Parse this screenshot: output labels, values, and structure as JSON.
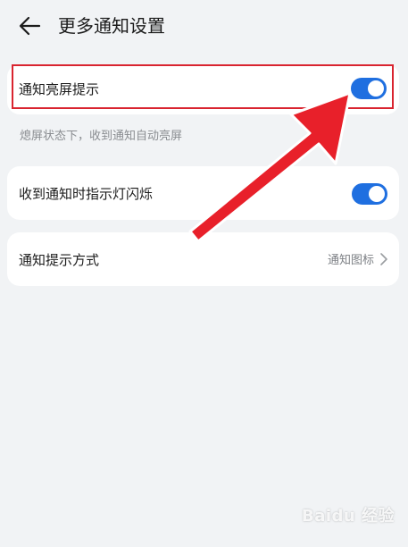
{
  "header": {
    "title": "更多通知设置",
    "back_icon": "arrow-left-icon"
  },
  "settings": {
    "screen_wake": {
      "label": "通知亮屏提示",
      "enabled": true,
      "hint": "熄屏状态下，收到通知自动亮屏"
    },
    "indicator_light": {
      "label": "收到通知时指示灯闪烁",
      "enabled": true
    },
    "notify_style": {
      "label": "通知提示方式",
      "value": "通知图标"
    }
  },
  "colors": {
    "background": "#f1f3f5",
    "card": "#ffffff",
    "accent": "#1f6fe0",
    "highlight": "#d9242f",
    "arrow": "#e8202a"
  },
  "watermark": "Baidu 经验"
}
